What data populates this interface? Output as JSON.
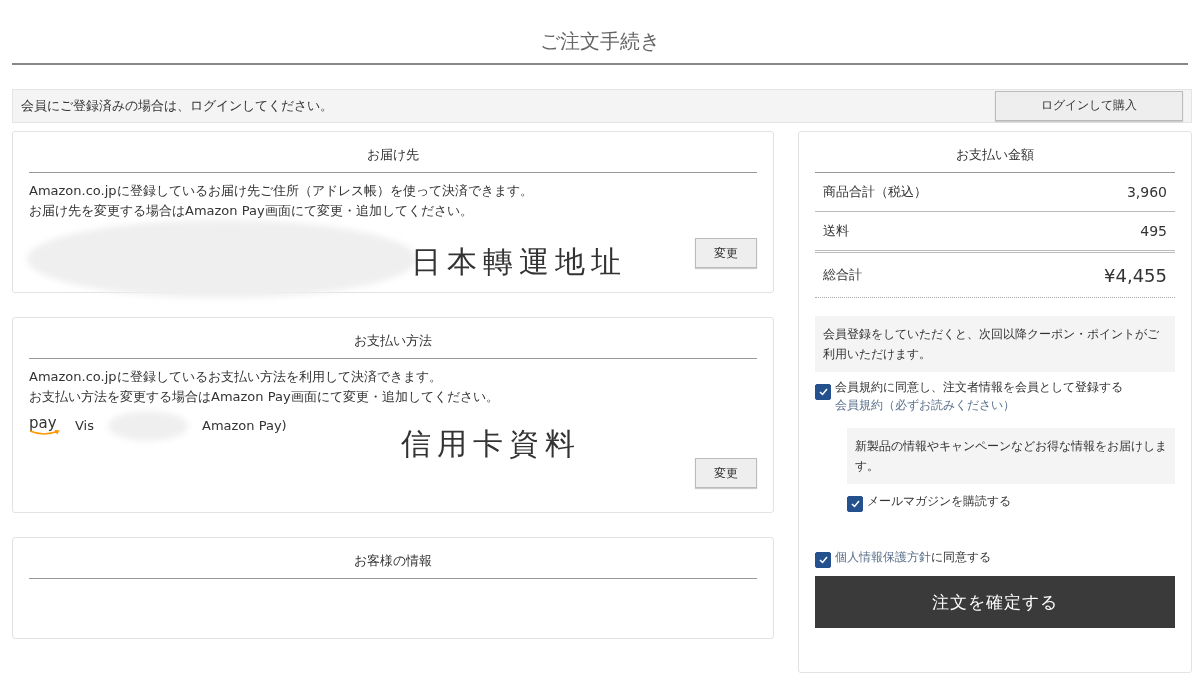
{
  "page_title": "ご注文手続き",
  "login_bar": {
    "message": "会員にご登録済みの場合は、ログインしてください。",
    "button": "ログインして購入"
  },
  "shipping": {
    "title": "お届け先",
    "lines": [
      "Amazon.co.jpに登録しているお届け先ご住所（アドレス帳）を使って決済できます。",
      "お届け先を変更する場合はAmazon Pay画面にて変更・追加してください。"
    ],
    "annotation": "日本轉運地址",
    "button": "変更"
  },
  "payment_method": {
    "title": "お支払い方法",
    "lines": [
      "Amazon.co.jpに登録しているお支払い方法を利用して決済できます。",
      "お支払い方法を変更する場合はAmazon Pay画面にて変更・追加してください。"
    ],
    "logo_text": "pay",
    "card_prefix": "Vis",
    "card_suffix": "Amazon Pay)",
    "annotation": "信用卡資料",
    "button": "変更"
  },
  "customer_info": {
    "title": "お客様の情報"
  },
  "summary": {
    "title": "お支払い金額",
    "rows": [
      {
        "label": "商品合計（税込）",
        "value": "3,960",
        "kind": "normal"
      },
      {
        "label": "送料",
        "value": "495",
        "kind": "normal"
      },
      {
        "label": "総合計",
        "value": "¥4,455",
        "kind": "total"
      }
    ],
    "member_note": "会員登録をしていただくと、次回以降クーポン・ポイントがご利用いただけます。",
    "register": {
      "label": "会員規約に同意し、注文者情報を会員として登録する",
      "link": "会員規約（必ずお読みください）",
      "checked": true
    },
    "newsletter_note": "新製品の情報やキャンペーンなどお得な情報をお届けします。",
    "newsletter": {
      "label": "メールマガジンを購読する",
      "checked": true
    },
    "privacy": {
      "link": "個人情報保護方針",
      "label": "に同意する",
      "checked": true
    },
    "confirm_button": "注文を確定する"
  }
}
